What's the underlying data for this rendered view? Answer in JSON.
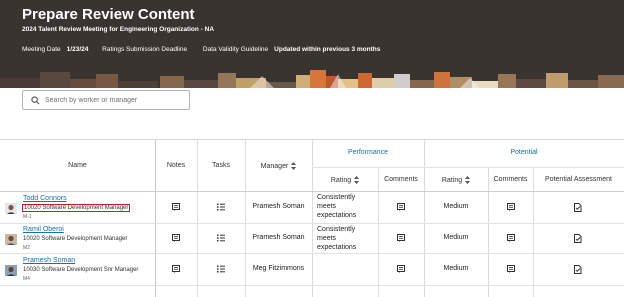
{
  "page": {
    "title": "Prepare Review Content",
    "subtitle": "2024 Talent Review Meeting for Engineering Organization - NA",
    "meeting_date_label": "Meeting Date",
    "meeting_date": "1/23/24",
    "ratings_deadline_label": "Ratings Submission Deadline",
    "validity_label": "Data Validity Guideline",
    "validity_value": "Updated within previous 3 months"
  },
  "search": {
    "placeholder": "Search by worker or manager",
    "icon": "search-icon"
  },
  "table": {
    "headers": {
      "name": "Name",
      "notes": "Notes",
      "tasks": "Tasks",
      "manager": "Manager",
      "performance": "Performance",
      "potential": "Potential",
      "perf_rating": "Rating",
      "perf_comments": "Comments",
      "pot_rating": "Rating",
      "pot_comments": "Comments",
      "potential_assessment": "Potential Assessment"
    },
    "rows": [
      {
        "name": "Todd Connors",
        "job": "10020 Software Development Manager",
        "level": "M-1",
        "manager": "Pramesh Soman",
        "performance_rating": "Consistently meets expectations",
        "potential_rating": "Medium"
      },
      {
        "name": "Ramil Oberoi",
        "job": "10020 Software Development Manager",
        "level": "M2",
        "manager": "Pramesh Soman",
        "performance_rating": "Consistently meets expectations",
        "potential_rating": "Medium"
      },
      {
        "name": "Pramesh Soman",
        "job": "10030 Software Development Snr Manager",
        "level": "M4",
        "manager": "Meg Fitzimmons",
        "performance_rating": "",
        "potential_rating": "Medium"
      }
    ]
  },
  "colors": {
    "header_bg": "#3a3431",
    "link": "#1a6fa6",
    "highlight_box": "#c8202a"
  }
}
